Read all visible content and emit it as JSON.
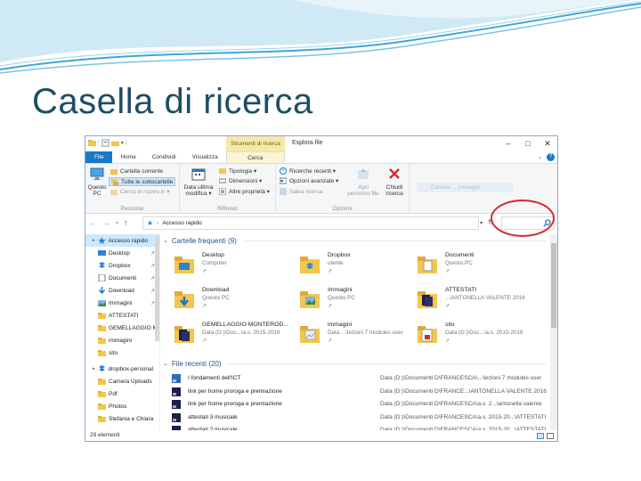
{
  "slide": {
    "title": "Casella di ricerca"
  },
  "window": {
    "title": "Esplora file",
    "context_tab": "Strumenti di ricerca",
    "controls": [
      "–",
      "□",
      "✕"
    ]
  },
  "ribbon_tabs": [
    "File",
    "Home",
    "Condividi",
    "Visualizza",
    "Cerca"
  ],
  "ribbon": {
    "percorso": {
      "label": "Percorso",
      "big_button": {
        "line1": "Questo",
        "line2": "PC"
      },
      "items": [
        "Cartella corrente",
        "Tutte le sottocartelle",
        "Cerca di nuovo in ▾"
      ]
    },
    "rifinisci": {
      "label": "Rifinisci",
      "big_button": {
        "line1": "Data ultima",
        "line2": "modifica ▾"
      },
      "items": [
        "Tipologia ▾",
        "Dimensioni ▾",
        "Altre proprietà ▾"
      ]
    },
    "opzioni": {
      "label": "Opzioni",
      "items": [
        "Ricerche recenti ▾",
        "Opzioni avanzate ▾",
        "Salva ricerca"
      ],
      "open_button": {
        "line1": "Apri",
        "line2": "percorso file"
      },
      "close_button": {
        "line1": "Chiudi",
        "line2": "ricerca"
      }
    },
    "faded_text": "Cartella ... immagini"
  },
  "address": {
    "separator": "›",
    "location": "Accesso rapido"
  },
  "nav": {
    "items": [
      {
        "label": "Accesso rapido",
        "icon": "star-icon",
        "pinned": false,
        "selected": true,
        "kind": "top"
      },
      {
        "label": "Desktop",
        "icon": "desktop-icon",
        "pinned": true
      },
      {
        "label": "Dropbox",
        "icon": "dropbox-icon",
        "pinned": true
      },
      {
        "label": "Documenti",
        "icon": "documents-icon",
        "pinned": true
      },
      {
        "label": "Download",
        "icon": "download-icon",
        "pinned": true
      },
      {
        "label": "Immagini",
        "icon": "pictures-icon",
        "pinned": true
      },
      {
        "label": "ATTESTATI",
        "icon": "folder-icon",
        "pinned": false
      },
      {
        "label": "GEMELLAGGIO M",
        "icon": "folder-icon",
        "pinned": false
      },
      {
        "label": "immagini",
        "icon": "folder-icon",
        "pinned": false
      },
      {
        "label": "sito",
        "icon": "folder-icon",
        "pinned": false
      },
      {
        "label": "dropbox-personal",
        "icon": "dropbox-icon",
        "pinned": false,
        "kind": "top"
      },
      {
        "label": "Camera Uploads",
        "icon": "folder-icon",
        "pinned": false
      },
      {
        "label": "Pdf",
        "icon": "folder-icon",
        "pinned": false
      },
      {
        "label": "Photos",
        "icon": "folder-icon",
        "pinned": false
      },
      {
        "label": "Stefania e Chiara",
        "icon": "folder-icon",
        "pinned": false
      }
    ]
  },
  "frequent": {
    "heading": "Cartelle frequenti (9)",
    "tiles": [
      {
        "name": "Desktop",
        "sub": "Computer",
        "icon": "desktop-folder-icon"
      },
      {
        "name": "Dropbox",
        "sub": "utente",
        "icon": "dropbox-folder-icon"
      },
      {
        "name": "Documenti",
        "sub": "Questo PC",
        "icon": "documents-folder-icon"
      },
      {
        "name": "Download",
        "sub": "Questo PC",
        "icon": "download-folder-icon"
      },
      {
        "name": "Immagini",
        "sub": "Questo PC",
        "icon": "pictures-folder-icon"
      },
      {
        "name": "ATTESTATI",
        "sub": "...\\ANTONELLA VALENTE 2016",
        "icon": "attestati-folder-icon"
      },
      {
        "name": "GEMELLAGGIO MONTEROD...",
        "sub": "Data (D:)\\Doc...\\a.s. 2015-2016",
        "icon": "gemellaggio-folder-icon"
      },
      {
        "name": "immagini",
        "sub": "Data ...\\lezioni 7 modules user",
        "icon": "immagini-folder-icon"
      },
      {
        "name": "sito",
        "sub": "Data (D:)\\Doc...\\a.s. 2015-2016",
        "icon": "sito-folder-icon"
      }
    ],
    "pin_glyph": "↗"
  },
  "recent": {
    "heading": "File recenti (20)",
    "files": [
      {
        "name": "I fondamenti dell'ICT",
        "path": "Data (D:)\\Documenti D\\FRANCESCA\\...\\lezioni 7 modules user",
        "icon": "ppt-file-icon"
      },
      {
        "name": "link per home proroga e premiazione",
        "path": "Data (D:)\\Documenti D\\FRANCE...\\ANTONELLA VALENTE 2016",
        "icon": "pdf-file-icon"
      },
      {
        "name": "link per home proroga e premiazione",
        "path": "Data (D:)\\Documenti D\\FRANCESCA\\a.s. 2...\\antonella valente",
        "icon": "pdf-file-icon"
      },
      {
        "name": "attestati 3 musicale",
        "path": "Data (D:)\\Documenti D\\FRANCESCA\\a.s. 2015-20...\\ATTESTATI",
        "icon": "pdf-file-icon"
      },
      {
        "name": "attestati 2 musicale",
        "path": "Data (D:)\\Documenti D\\FRANCESCA\\a.s. 2015-20...\\ATTESTATI",
        "icon": "pdf-file-icon"
      }
    ]
  },
  "status": {
    "count": "29 elementi"
  },
  "colors": {
    "title": "#1f4e62",
    "accent": "#1979ca",
    "highlight": "#d22b2b",
    "folder": "#f3c64c"
  }
}
